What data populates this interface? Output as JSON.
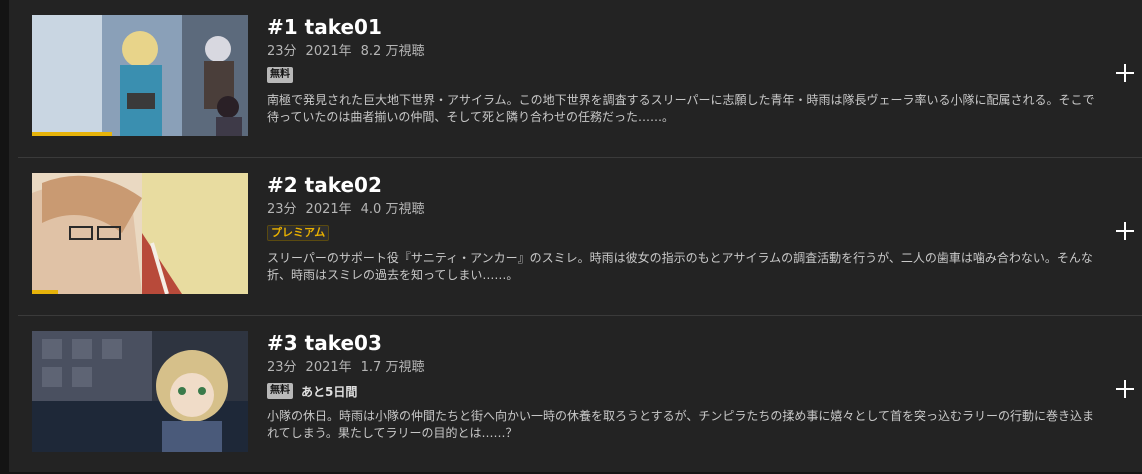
{
  "episodes": [
    {
      "title": "#1 take01",
      "duration": "23分",
      "year": "2021年",
      "views": "8.2 万視聴",
      "badge": "無料",
      "badge_type": "free",
      "remaining": "",
      "description": "南極で発見された巨大地下世界・アサイラム。この地下世界を調査するスリーパーに志願した青年・時雨は隊長ヴェーラ率いる小隊に配属される。そこで待っていたのは曲者揃いの仲間、そして死と隣り合わせの任務だった……。",
      "watch_progress": 0.37
    },
    {
      "title": "#2 take02",
      "duration": "23分",
      "year": "2021年",
      "views": "4.0 万視聴",
      "badge": "プレミアム",
      "badge_type": "premium",
      "remaining": "",
      "description": "スリーパーのサポート役『サニティ・アンカー』のスミレ。時雨は彼女の指示のもとアサイラムの調査活動を行うが、二人の歯車は噛み合わない。そんな折、時雨はスミレの過去を知ってしまい……。",
      "watch_progress": 0.12
    },
    {
      "title": "#3 take03",
      "duration": "23分",
      "year": "2021年",
      "views": "1.7 万視聴",
      "badge": "無料",
      "badge_type": "free",
      "remaining": "あと5日間",
      "description": "小隊の休日。時雨は小隊の仲間たちと街へ向かい一時の休養を取ろうとするが、チンピラたちの揉め事に嬉々として首を突っ込むラリーの行動に巻き込まれてしまう。果たしてラリーの目的とは……？",
      "watch_progress": 0
    }
  ],
  "colors": {
    "background": "#232323",
    "progress": "#e6b30a",
    "premium": "#e8b000"
  },
  "icons": {
    "add": "plus-icon"
  }
}
